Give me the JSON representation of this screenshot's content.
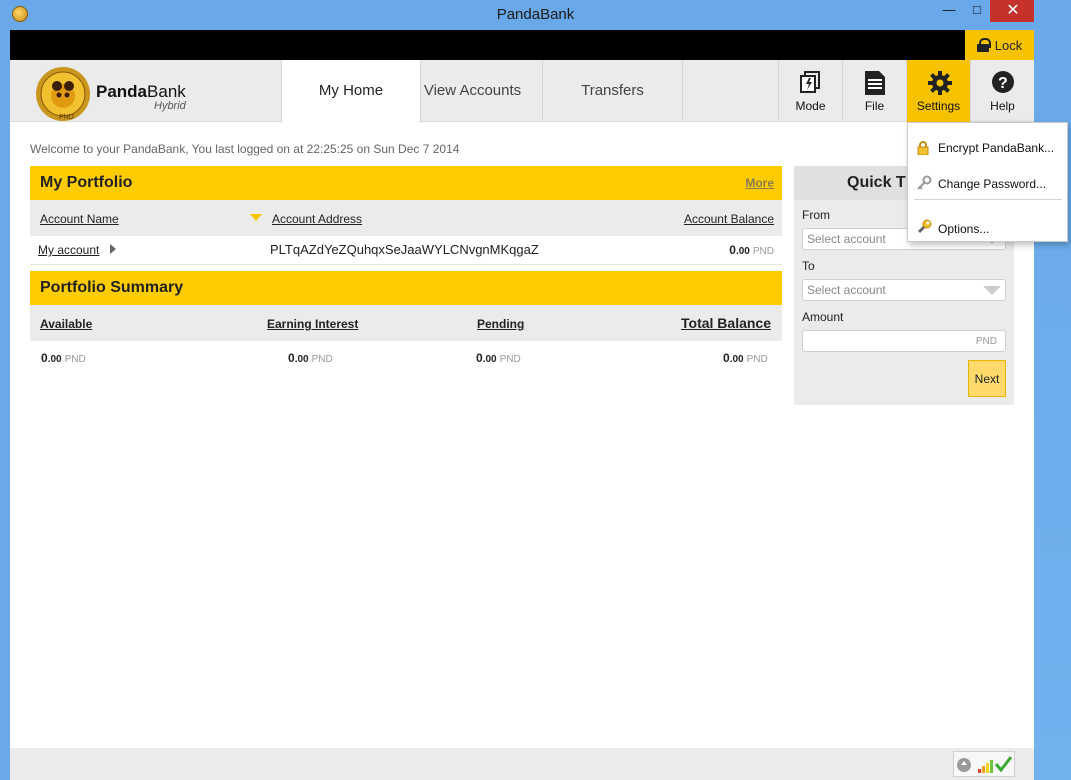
{
  "window": {
    "title": "PandaBank"
  },
  "lock": {
    "label": "Lock"
  },
  "brand": {
    "name_bold": "Panda",
    "name_rest": "Bank",
    "subtitle": "Hybrid",
    "coin_text": "PND"
  },
  "tabs": [
    {
      "label": "My Home",
      "active": true
    },
    {
      "label": "View Accounts",
      "active": false
    },
    {
      "label": "Transfers",
      "active": false
    }
  ],
  "tools": [
    {
      "label": "Mode",
      "icon": "lightning-mode-icon"
    },
    {
      "label": "File",
      "icon": "document-icon"
    },
    {
      "label": "Settings",
      "icon": "gear-icon",
      "active": true
    },
    {
      "label": "Help",
      "icon": "help-icon"
    }
  ],
  "welcome": "Welcome to your PandaBank, You last logged on at 22:25:25 on Sun Dec 7 2014",
  "portfolio": {
    "title": "My Portfolio",
    "more": "More",
    "columns": [
      "Account Name",
      "Account Address",
      "Account Balance"
    ],
    "rows": [
      {
        "name": "My account",
        "address": "PLTqAZdYeZQuhqxSeJaaWYLCNvgnMKqgaZ",
        "int": "0",
        "dec": ".00",
        "currency": "PND"
      }
    ]
  },
  "summary": {
    "title": "Portfolio Summary",
    "columns": [
      "Available",
      "Earning Interest",
      "Pending",
      "Total Balance"
    ],
    "values": [
      {
        "int": "0",
        "dec": ".00",
        "currency": "PND"
      },
      {
        "int": "0",
        "dec": ".00",
        "currency": "PND"
      },
      {
        "int": "0",
        "dec": ".00",
        "currency": "PND"
      },
      {
        "int": "0",
        "dec": ".00",
        "currency": "PND"
      }
    ]
  },
  "quick": {
    "title": "Quick T",
    "from_label": "From",
    "from_value": "Select account",
    "to_label": "To",
    "to_value": "Select account",
    "amount_label": "Amount",
    "amount_unit": "PND",
    "next": "Next"
  },
  "settings_menu": [
    {
      "label": "Encrypt PandaBank...",
      "icon": "lock-icon"
    },
    {
      "label": "Change Password...",
      "icon": "key-icon"
    },
    {
      "label": "Options...",
      "icon": "wrench-icon"
    }
  ],
  "colors": {
    "accent": "#ffcc00",
    "titlebar": "#6aa9e9",
    "close": "#c7312c"
  }
}
